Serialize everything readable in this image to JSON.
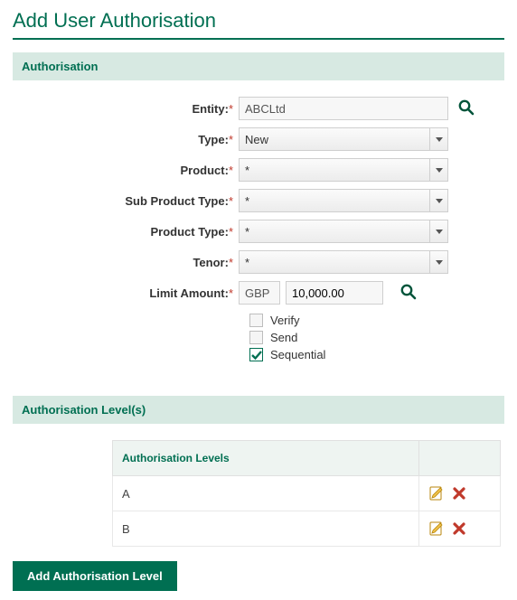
{
  "page": {
    "title": "Add User Authorisation"
  },
  "sections": {
    "auth": "Authorisation",
    "levels": "Authorisation Level(s)"
  },
  "form": {
    "entity": {
      "label": "Entity:",
      "value": "ABCLtd"
    },
    "type": {
      "label": "Type:",
      "value": "New"
    },
    "product": {
      "label": "Product:",
      "value": "*"
    },
    "subProductType": {
      "label": "Sub Product Type:",
      "value": "*"
    },
    "productType": {
      "label": "Product Type:",
      "value": "*"
    },
    "tenor": {
      "label": "Tenor:",
      "value": "*"
    },
    "limitAmount": {
      "label": "Limit Amount:",
      "currency": "GBP",
      "value": "10,000.00"
    },
    "verify": {
      "label": "Verify",
      "checked": false
    },
    "send": {
      "label": "Send",
      "checked": false
    },
    "sequential": {
      "label": "Sequential",
      "checked": true
    },
    "requiredMark": "*"
  },
  "levelsTable": {
    "header": "Authorisation Levels",
    "rows": [
      {
        "level": "A"
      },
      {
        "level": "B"
      }
    ]
  },
  "buttons": {
    "addLevel": "Add Authorisation Level"
  },
  "colors": {
    "brand": "#006f52",
    "sectionBg": "#d7e9e2",
    "danger": "#c0392b"
  }
}
